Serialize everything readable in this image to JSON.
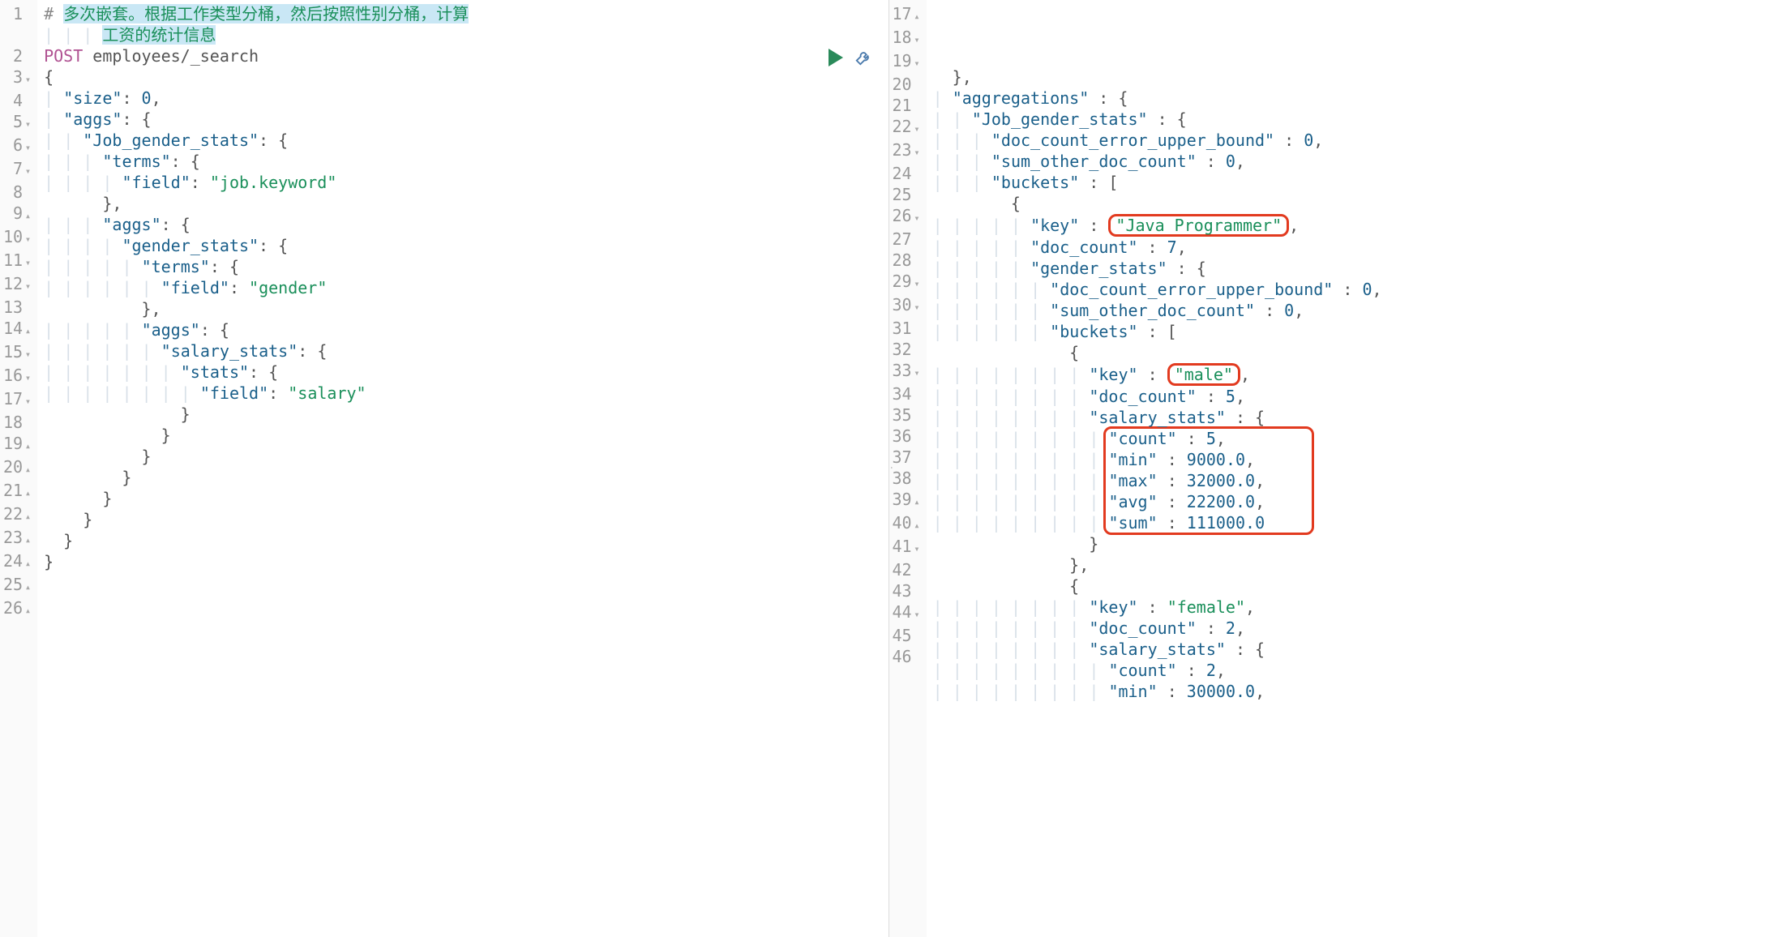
{
  "left": {
    "lines": [
      {
        "n": "1",
        "fold": "",
        "html": [
          {
            "t": "# ",
            "c": "comment-hash"
          },
          {
            "t": "多次嵌套。根据工作类型分桶，然后按照性别分桶，计算",
            "c": "comment-text"
          }
        ]
      },
      {
        "n": "",
        "fold": "",
        "html": [
          {
            "t": "      ",
            "c": ""
          },
          {
            "t": "工资的统计信息",
            "c": "comment-text"
          }
        ]
      },
      {
        "n": "2",
        "fold": "",
        "html": [
          {
            "t": "POST",
            "c": "method"
          },
          {
            "t": " employees/_search",
            "c": "path"
          }
        ]
      },
      {
        "n": "3",
        "fold": "▾",
        "html": [
          {
            "t": "{",
            "c": "punct"
          }
        ]
      },
      {
        "n": "4",
        "fold": "",
        "html": [
          {
            "t": "  ",
            "c": ""
          },
          {
            "t": "\"size\"",
            "c": "key"
          },
          {
            "t": ": ",
            "c": "punct"
          },
          {
            "t": "0",
            "c": "number"
          },
          {
            "t": ",",
            "c": "punct"
          }
        ]
      },
      {
        "n": "5",
        "fold": "▾",
        "html": [
          {
            "t": "  ",
            "c": ""
          },
          {
            "t": "\"aggs\"",
            "c": "key"
          },
          {
            "t": ": {",
            "c": "punct"
          }
        ]
      },
      {
        "n": "6",
        "fold": "▾",
        "html": [
          {
            "t": "    ",
            "c": ""
          },
          {
            "t": "\"Job_gender_stats\"",
            "c": "key"
          },
          {
            "t": ": {",
            "c": "punct"
          }
        ]
      },
      {
        "n": "7",
        "fold": "▾",
        "html": [
          {
            "t": "      ",
            "c": ""
          },
          {
            "t": "\"terms\"",
            "c": "key"
          },
          {
            "t": ": {",
            "c": "punct"
          }
        ]
      },
      {
        "n": "8",
        "fold": "",
        "html": [
          {
            "t": "        ",
            "c": ""
          },
          {
            "t": "\"field\"",
            "c": "key"
          },
          {
            "t": ": ",
            "c": "punct"
          },
          {
            "t": "\"job.keyword\"",
            "c": "string"
          }
        ]
      },
      {
        "n": "9",
        "fold": "▴",
        "html": [
          {
            "t": "      },",
            "c": "punct"
          }
        ]
      },
      {
        "n": "10",
        "fold": "▾",
        "html": [
          {
            "t": "      ",
            "c": ""
          },
          {
            "t": "\"aggs\"",
            "c": "key"
          },
          {
            "t": ": {",
            "c": "punct"
          }
        ]
      },
      {
        "n": "11",
        "fold": "▾",
        "html": [
          {
            "t": "        ",
            "c": ""
          },
          {
            "t": "\"gender_stats\"",
            "c": "key"
          },
          {
            "t": ": {",
            "c": "punct"
          }
        ]
      },
      {
        "n": "12",
        "fold": "▾",
        "html": [
          {
            "t": "          ",
            "c": ""
          },
          {
            "t": "\"terms\"",
            "c": "key"
          },
          {
            "t": ": {",
            "c": "punct"
          }
        ]
      },
      {
        "n": "13",
        "fold": "",
        "html": [
          {
            "t": "            ",
            "c": ""
          },
          {
            "t": "\"field\"",
            "c": "key"
          },
          {
            "t": ": ",
            "c": "punct"
          },
          {
            "t": "\"gender\"",
            "c": "string"
          }
        ]
      },
      {
        "n": "14",
        "fold": "▴",
        "html": [
          {
            "t": "          },",
            "c": "punct"
          }
        ]
      },
      {
        "n": "15",
        "fold": "▾",
        "html": [
          {
            "t": "          ",
            "c": ""
          },
          {
            "t": "\"aggs\"",
            "c": "key"
          },
          {
            "t": ": {",
            "c": "punct"
          }
        ]
      },
      {
        "n": "16",
        "fold": "▾",
        "html": [
          {
            "t": "            ",
            "c": ""
          },
          {
            "t": "\"salary_stats\"",
            "c": "key"
          },
          {
            "t": ": {",
            "c": "punct"
          }
        ]
      },
      {
        "n": "17",
        "fold": "▾",
        "html": [
          {
            "t": "              ",
            "c": ""
          },
          {
            "t": "\"stats\"",
            "c": "key"
          },
          {
            "t": ": {",
            "c": "punct"
          }
        ]
      },
      {
        "n": "18",
        "fold": "",
        "html": [
          {
            "t": "                ",
            "c": ""
          },
          {
            "t": "\"field\"",
            "c": "key"
          },
          {
            "t": ": ",
            "c": "punct"
          },
          {
            "t": "\"salary\"",
            "c": "string"
          }
        ]
      },
      {
        "n": "19",
        "fold": "▴",
        "html": [
          {
            "t": "              }",
            "c": "punct"
          }
        ]
      },
      {
        "n": "20",
        "fold": "▴",
        "html": [
          {
            "t": "            }",
            "c": "punct"
          }
        ]
      },
      {
        "n": "21",
        "fold": "▴",
        "html": [
          {
            "t": "          }",
            "c": "punct"
          }
        ]
      },
      {
        "n": "22",
        "fold": "▴",
        "html": [
          {
            "t": "        }",
            "c": "punct"
          }
        ]
      },
      {
        "n": "23",
        "fold": "▴",
        "html": [
          {
            "t": "      }",
            "c": "punct"
          }
        ]
      },
      {
        "n": "24",
        "fold": "▴",
        "html": [
          {
            "t": "    }",
            "c": "punct"
          }
        ]
      },
      {
        "n": "25",
        "fold": "▴",
        "html": [
          {
            "t": "  }",
            "c": "punct"
          }
        ]
      },
      {
        "n": "26",
        "fold": "▴",
        "html": [
          {
            "t": "}",
            "c": "punct"
          }
        ]
      }
    ]
  },
  "right": {
    "lines": [
      {
        "n": "17",
        "fold": "▴",
        "html": [
          {
            "t": "  },",
            "c": "punct"
          }
        ]
      },
      {
        "n": "18",
        "fold": "▾",
        "html": [
          {
            "t": "  ",
            "c": ""
          },
          {
            "t": "\"aggregations\"",
            "c": "key"
          },
          {
            "t": " : {",
            "c": "punct"
          }
        ]
      },
      {
        "n": "19",
        "fold": "▾",
        "html": [
          {
            "t": "    ",
            "c": ""
          },
          {
            "t": "\"Job_gender_stats\"",
            "c": "key"
          },
          {
            "t": " : {",
            "c": "punct"
          }
        ]
      },
      {
        "n": "20",
        "fold": "",
        "html": [
          {
            "t": "      ",
            "c": ""
          },
          {
            "t": "\"doc_count_error_upper_bound\"",
            "c": "key"
          },
          {
            "t": " : ",
            "c": "punct"
          },
          {
            "t": "0",
            "c": "number"
          },
          {
            "t": ",",
            "c": "punct"
          }
        ]
      },
      {
        "n": "21",
        "fold": "",
        "html": [
          {
            "t": "      ",
            "c": ""
          },
          {
            "t": "\"sum_other_doc_count\"",
            "c": "key"
          },
          {
            "t": " : ",
            "c": "punct"
          },
          {
            "t": "0",
            "c": "number"
          },
          {
            "t": ",",
            "c": "punct"
          }
        ]
      },
      {
        "n": "22",
        "fold": "▾",
        "html": [
          {
            "t": "      ",
            "c": ""
          },
          {
            "t": "\"buckets\"",
            "c": "key"
          },
          {
            "t": " : [",
            "c": "punct"
          }
        ]
      },
      {
        "n": "23",
        "fold": "▾",
        "html": [
          {
            "t": "        {",
            "c": "punct"
          }
        ]
      },
      {
        "n": "24",
        "fold": "",
        "html": [
          {
            "t": "          ",
            "c": ""
          },
          {
            "t": "\"key\"",
            "c": "key"
          },
          {
            "t": " : ",
            "c": "punct"
          },
          {
            "t": "\"Java Programmer\"",
            "c": "string hl",
            "hl": "key-java"
          },
          {
            "t": ",",
            "c": "punct"
          }
        ]
      },
      {
        "n": "25",
        "fold": "",
        "html": [
          {
            "t": "          ",
            "c": ""
          },
          {
            "t": "\"doc_count\"",
            "c": "key"
          },
          {
            "t": " : ",
            "c": "punct"
          },
          {
            "t": "7",
            "c": "number"
          },
          {
            "t": ",",
            "c": "punct"
          }
        ]
      },
      {
        "n": "26",
        "fold": "▾",
        "html": [
          {
            "t": "          ",
            "c": ""
          },
          {
            "t": "\"gender_stats\"",
            "c": "key"
          },
          {
            "t": " : {",
            "c": "punct"
          }
        ]
      },
      {
        "n": "27",
        "fold": "",
        "html": [
          {
            "t": "            ",
            "c": ""
          },
          {
            "t": "\"doc_count_error_upper_bound\"",
            "c": "key"
          },
          {
            "t": " : ",
            "c": "punct"
          },
          {
            "t": "0",
            "c": "number"
          },
          {
            "t": ",",
            "c": "punct"
          }
        ]
      },
      {
        "n": "28",
        "fold": "",
        "html": [
          {
            "t": "            ",
            "c": ""
          },
          {
            "t": "\"sum_other_doc_count\"",
            "c": "key"
          },
          {
            "t": " : ",
            "c": "punct"
          },
          {
            "t": "0",
            "c": "number"
          },
          {
            "t": ",",
            "c": "punct"
          }
        ]
      },
      {
        "n": "29",
        "fold": "▾",
        "html": [
          {
            "t": "            ",
            "c": ""
          },
          {
            "t": "\"buckets\"",
            "c": "key"
          },
          {
            "t": " : [",
            "c": "punct"
          }
        ]
      },
      {
        "n": "30",
        "fold": "▾",
        "html": [
          {
            "t": "              {",
            "c": "punct"
          }
        ]
      },
      {
        "n": "31",
        "fold": "",
        "html": [
          {
            "t": "                ",
            "c": ""
          },
          {
            "t": "\"key\"",
            "c": "key"
          },
          {
            "t": " : ",
            "c": "punct"
          },
          {
            "t": "\"male\"",
            "c": "string hl",
            "hl": "key-male"
          },
          {
            "t": ",",
            "c": "punct"
          }
        ]
      },
      {
        "n": "32",
        "fold": "",
        "html": [
          {
            "t": "                ",
            "c": ""
          },
          {
            "t": "\"doc_count\"",
            "c": "key"
          },
          {
            "t": " : ",
            "c": "punct"
          },
          {
            "t": "5",
            "c": "number"
          },
          {
            "t": ",",
            "c": "punct"
          }
        ]
      },
      {
        "n": "33",
        "fold": "▾",
        "html": [
          {
            "t": "                ",
            "c": ""
          },
          {
            "t": "\"salary_stats\"",
            "c": "key"
          },
          {
            "t": " : {",
            "c": "punct"
          }
        ]
      },
      {
        "n": "34",
        "fold": "",
        "html": [
          {
            "t": "                  ",
            "c": ""
          },
          {
            "t": "\"count\"",
            "c": "key"
          },
          {
            "t": " : ",
            "c": "punct"
          },
          {
            "t": "5",
            "c": "number"
          },
          {
            "t": ",",
            "c": "punct"
          }
        ]
      },
      {
        "n": "35",
        "fold": "",
        "html": [
          {
            "t": "                  ",
            "c": ""
          },
          {
            "t": "\"min\"",
            "c": "key"
          },
          {
            "t": " : ",
            "c": "punct"
          },
          {
            "t": "9000.0",
            "c": "number"
          },
          {
            "t": ",",
            "c": "punct"
          }
        ]
      },
      {
        "n": "36",
        "fold": "",
        "html": [
          {
            "t": "                  ",
            "c": ""
          },
          {
            "t": "\"max\"",
            "c": "key"
          },
          {
            "t": " : ",
            "c": "punct"
          },
          {
            "t": "32000.0",
            "c": "number"
          },
          {
            "t": ",",
            "c": "punct"
          }
        ]
      },
      {
        "n": "37",
        "fold": "",
        "html": [
          {
            "t": "                  ",
            "c": ""
          },
          {
            "t": "\"avg\"",
            "c": "key"
          },
          {
            "t": " : ",
            "c": "punct"
          },
          {
            "t": "22200.0",
            "c": "number"
          },
          {
            "t": ",",
            "c": "punct"
          }
        ]
      },
      {
        "n": "38",
        "fold": "",
        "html": [
          {
            "t": "                  ",
            "c": ""
          },
          {
            "t": "\"sum\"",
            "c": "key"
          },
          {
            "t": " : ",
            "c": "punct"
          },
          {
            "t": "111000.0",
            "c": "number"
          }
        ]
      },
      {
        "n": "39",
        "fold": "▴",
        "html": [
          {
            "t": "                }",
            "c": "punct"
          }
        ]
      },
      {
        "n": "40",
        "fold": "▴",
        "html": [
          {
            "t": "              },",
            "c": "punct"
          }
        ]
      },
      {
        "n": "41",
        "fold": "▾",
        "html": [
          {
            "t": "              {",
            "c": "punct"
          }
        ]
      },
      {
        "n": "42",
        "fold": "",
        "html": [
          {
            "t": "                ",
            "c": ""
          },
          {
            "t": "\"key\"",
            "c": "key"
          },
          {
            "t": " : ",
            "c": "punct"
          },
          {
            "t": "\"female\"",
            "c": "string"
          },
          {
            "t": ",",
            "c": "punct"
          }
        ]
      },
      {
        "n": "43",
        "fold": "",
        "html": [
          {
            "t": "                ",
            "c": ""
          },
          {
            "t": "\"doc_count\"",
            "c": "key"
          },
          {
            "t": " : ",
            "c": "punct"
          },
          {
            "t": "2",
            "c": "number"
          },
          {
            "t": ",",
            "c": "punct"
          }
        ]
      },
      {
        "n": "44",
        "fold": "▾",
        "html": [
          {
            "t": "                ",
            "c": ""
          },
          {
            "t": "\"salary_stats\"",
            "c": "key"
          },
          {
            "t": " : {",
            "c": "punct"
          }
        ]
      },
      {
        "n": "45",
        "fold": "",
        "html": [
          {
            "t": "                  ",
            "c": ""
          },
          {
            "t": "\"count\"",
            "c": "key"
          },
          {
            "t": " : ",
            "c": "punct"
          },
          {
            "t": "2",
            "c": "number"
          },
          {
            "t": ",",
            "c": "punct"
          }
        ]
      },
      {
        "n": "46",
        "fold": "",
        "html": [
          {
            "t": "                  ",
            "c": ""
          },
          {
            "t": "\"min\"",
            "c": "key"
          },
          {
            "t": " : ",
            "c": "punct"
          },
          {
            "t": "30000.0",
            "c": "number"
          },
          {
            "t": ",",
            "c": "punct"
          }
        ]
      }
    ]
  },
  "highlight_block": {
    "top_line": 17,
    "bottom_line": 21
  }
}
